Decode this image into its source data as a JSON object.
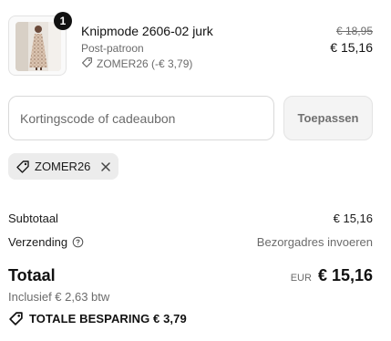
{
  "line_item": {
    "quantity": "1",
    "title": "Knipmode 2606-02 jurk",
    "variant": "Post-patroon",
    "discount": "ZOMER26 (-€ 3,79)",
    "price_original": "€ 18,95",
    "price_final": "€ 15,16",
    "thumbnail_icon": "dress-product-image"
  },
  "discount_form": {
    "placeholder": "Kortingscode of cadeaubon",
    "value": "",
    "apply_label": "Toepassen"
  },
  "applied_code": {
    "code": "ZOMER26",
    "remove_icon": "close-icon",
    "tag_icon": "tag-icon"
  },
  "summary": {
    "subtotal_label": "Subtotaal",
    "subtotal_value": "€ 15,16",
    "shipping_label": "Verzending",
    "shipping_value": "Bezorgadres invoeren",
    "shipping_help_icon": "question-circle-icon",
    "total_label": "Totaal",
    "total_currency": "EUR",
    "total_value": "€ 15,16",
    "tax_note": "Inclusief € 2,63 btw",
    "savings_text": "TOTALE BESPARING € 3,79",
    "savings_icon": "tag-icon"
  },
  "colors": {
    "text": "#1a1a1a",
    "muted": "#6b6b6b",
    "chip_bg": "#ececec",
    "button_bg": "#f4f4f4",
    "badge_bg": "#111111"
  }
}
